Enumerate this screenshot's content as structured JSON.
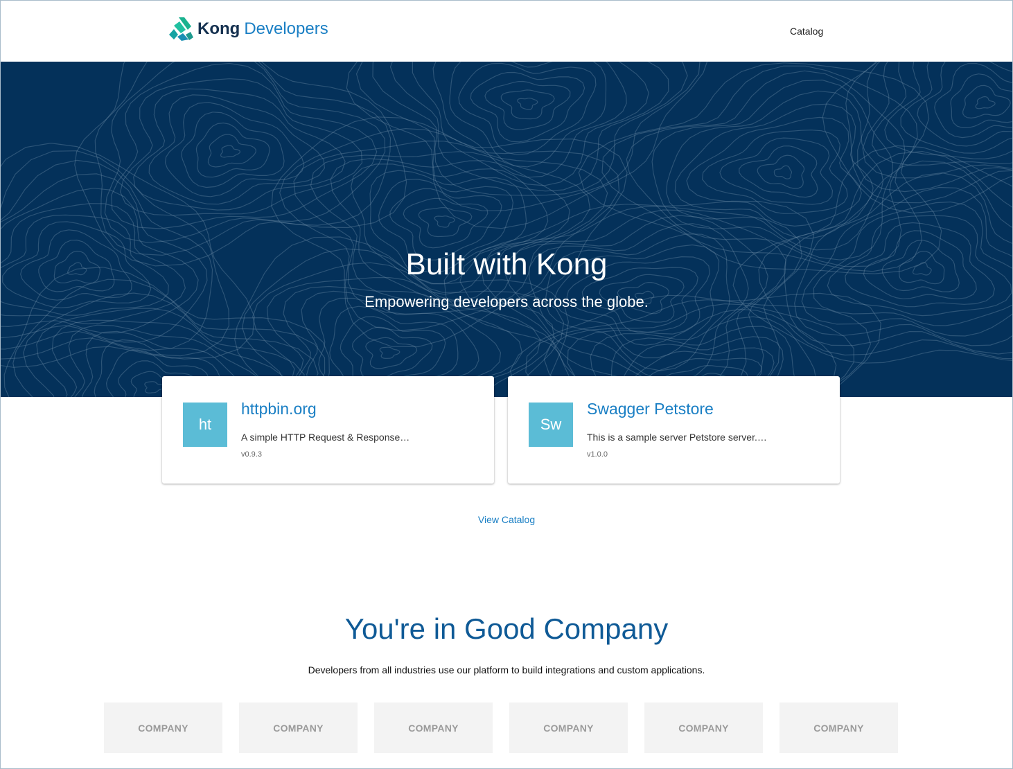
{
  "header": {
    "brand_primary": "Kong",
    "brand_secondary": "Developers",
    "nav": [
      {
        "label": "Catalog"
      }
    ]
  },
  "hero": {
    "title": "Built with Kong",
    "subtitle": "Empowering developers across the globe."
  },
  "cards": [
    {
      "badge": "ht",
      "title": "httpbin.org",
      "description": "A simple HTTP Request & Response…",
      "version": "v0.9.3"
    },
    {
      "badge": "Sw",
      "title": "Swagger Petstore",
      "description": "This is a sample server Petstore server. Yo…",
      "version": "v1.0.0"
    }
  ],
  "view_catalog_label": "View Catalog",
  "good_company": {
    "title": "You're in Good Company",
    "subtitle": "Developers from all industries use our platform to build integrations and custom applications.",
    "companies": [
      "COMPANY",
      "COMPANY",
      "COMPANY",
      "COMPANY",
      "COMPANY",
      "COMPANY"
    ]
  },
  "colors": {
    "hero_bg": "#04315a",
    "link": "#1a7fc4",
    "badge": "#5bbcd6",
    "heading": "#0f5a96"
  },
  "icons": {
    "logo": "kong-logo-icon"
  }
}
